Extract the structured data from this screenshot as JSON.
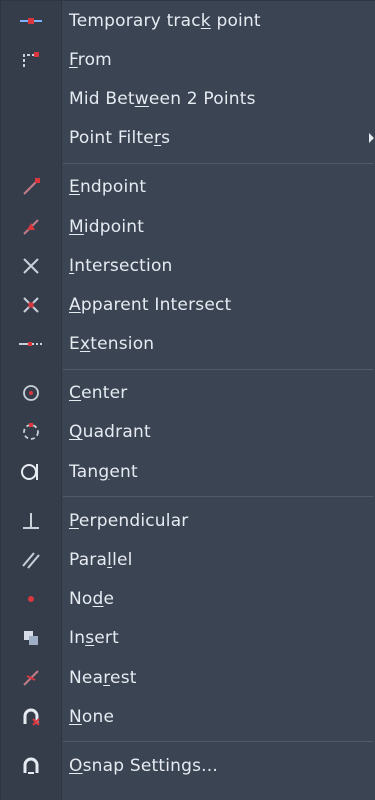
{
  "menu": {
    "items": [
      {
        "pre": "Temporary trac",
        "key": "k",
        "post": " point",
        "icon": "temporary-track-icon"
      },
      {
        "pre": "",
        "key": "F",
        "post": "rom",
        "icon": "from-icon"
      },
      {
        "pre": "Mid Bet",
        "key": "w",
        "post": "een 2 Points",
        "icon": ""
      },
      {
        "pre": "Point Filte",
        "key": "r",
        "post": "s",
        "icon": "",
        "submenu": true
      },
      {
        "pre": "",
        "key": "E",
        "post": "ndpoint",
        "icon": "endpoint-icon"
      },
      {
        "pre": "",
        "key": "M",
        "post": "idpoint",
        "icon": "midpoint-icon"
      },
      {
        "pre": "",
        "key": "I",
        "post": "ntersection",
        "icon": "intersection-icon"
      },
      {
        "pre": "",
        "key": "A",
        "post": "pparent Intersect",
        "icon": "apparent-intersect-icon"
      },
      {
        "pre": "E",
        "key": "x",
        "post": "tension",
        "icon": "extension-icon"
      },
      {
        "pre": "",
        "key": "C",
        "post": "enter",
        "icon": "center-icon"
      },
      {
        "pre": "",
        "key": "Q",
        "post": "uadrant",
        "icon": "quadrant-icon"
      },
      {
        "pre": "Tan",
        "key": "g",
        "post": "ent",
        "icon": "tangent-icon"
      },
      {
        "pre": "",
        "key": "P",
        "post": "erpendicular",
        "icon": "perpendicular-icon"
      },
      {
        "pre": "Para",
        "key": "l",
        "post": "lel",
        "icon": "parallel-icon"
      },
      {
        "pre": "No",
        "key": "d",
        "post": "e",
        "icon": "node-icon"
      },
      {
        "pre": "In",
        "key": "s",
        "post": "ert",
        "icon": "insert-icon"
      },
      {
        "pre": "Nea",
        "key": "r",
        "post": "est",
        "icon": "nearest-icon"
      },
      {
        "pre": "",
        "key": "N",
        "post": "one",
        "icon": "none-icon"
      },
      {
        "pre": "",
        "key": "O",
        "post": "snap Settings...",
        "icon": "osnap-settings-icon"
      }
    ]
  },
  "colors": {
    "background": "#3b4453",
    "text": "#e6ebf2",
    "accent_red": "#d9363e",
    "icon_gray": "#c9d0da"
  }
}
